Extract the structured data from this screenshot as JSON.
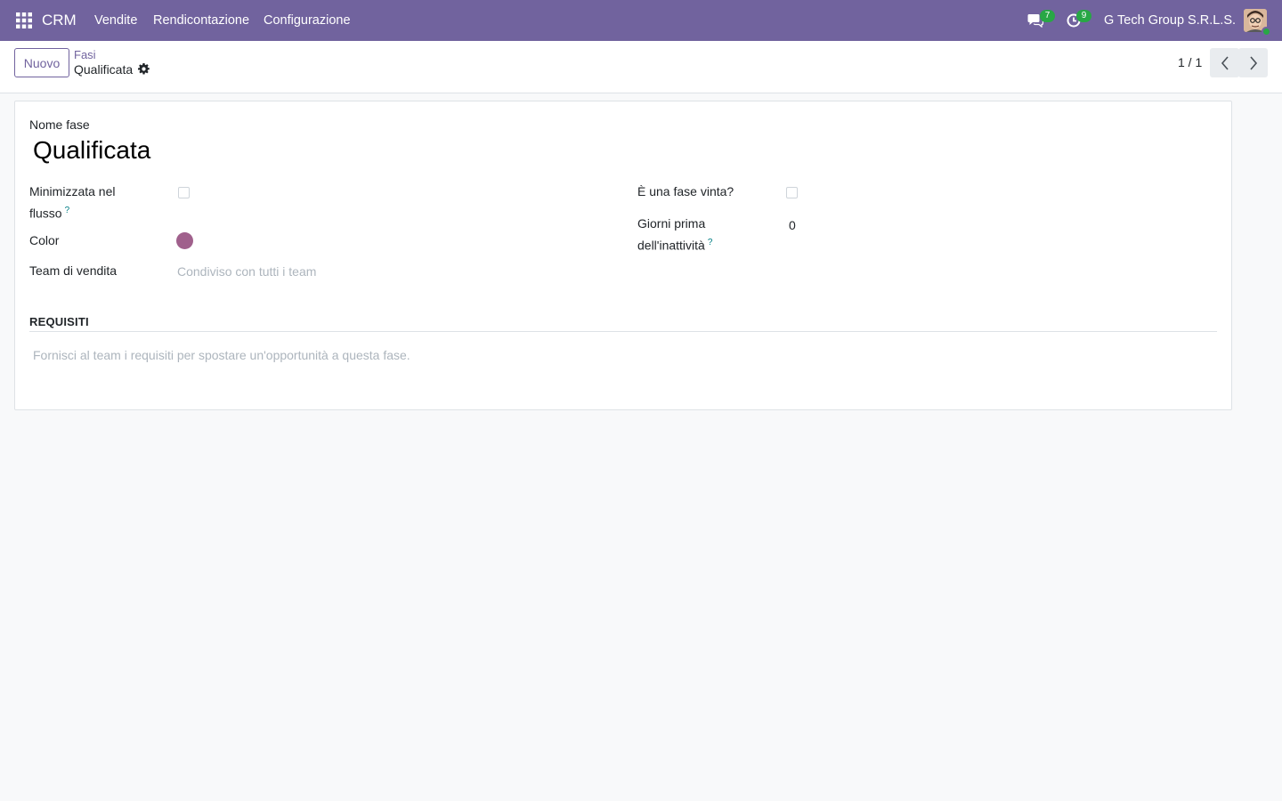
{
  "navbar": {
    "app_name": "CRM",
    "menus": [
      "Vendite",
      "Rendicontazione",
      "Configurazione"
    ],
    "messages_count": "7",
    "activities_count": "9",
    "company": "G Tech Group S.R.L.S.",
    "background_color": "#71639e"
  },
  "control_panel": {
    "new_button": "Nuovo",
    "breadcrumb_parent": "Fasi",
    "breadcrumb_current": "Qualificata",
    "pager": "1 / 1"
  },
  "form": {
    "name_label": "Nome fase",
    "name_value": "Qualificata",
    "fold_label_line1": "Minimizzata nel",
    "fold_label_line2": "flusso",
    "fold_checked": false,
    "color_label": "Color",
    "color_value": "#a0608c",
    "team_label": "Team di vendita",
    "team_placeholder": "Condiviso con tutti i team",
    "won_label": "È una fase vinta?",
    "won_checked": false,
    "rotting_label_line1": "Giorni prima",
    "rotting_label_line2": "dell'inattività",
    "rotting_value": "0",
    "help_mark": "?",
    "requirements_title": "REQUISITI",
    "requirements_placeholder": "Fornisci al team i requisiti per spostare un'opportunità a questa fase."
  }
}
